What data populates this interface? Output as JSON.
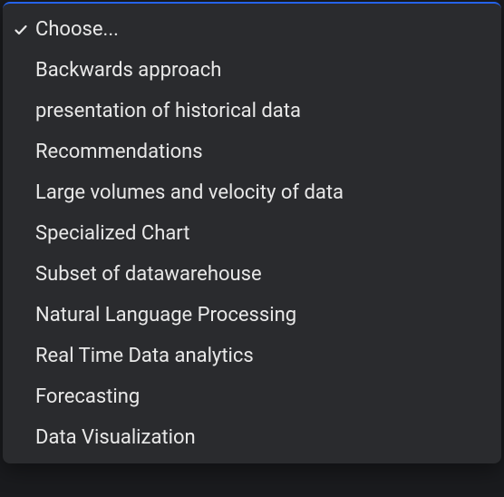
{
  "dropdown": {
    "items": [
      {
        "label": "Choose...",
        "selected": true
      },
      {
        "label": "Backwards approach",
        "selected": false
      },
      {
        "label": "presentation of historical data",
        "selected": false
      },
      {
        "label": "Recommendations",
        "selected": false
      },
      {
        "label": "Large volumes and velocity of data",
        "selected": false
      },
      {
        "label": "Specialized Chart",
        "selected": false
      },
      {
        "label": "Subset of datawarehouse",
        "selected": false
      },
      {
        "label": "Natural Language Processing",
        "selected": false
      },
      {
        "label": "Real Time Data analytics",
        "selected": false
      },
      {
        "label": "Forecasting",
        "selected": false
      },
      {
        "label": "Data Visualization",
        "selected": false
      }
    ]
  }
}
